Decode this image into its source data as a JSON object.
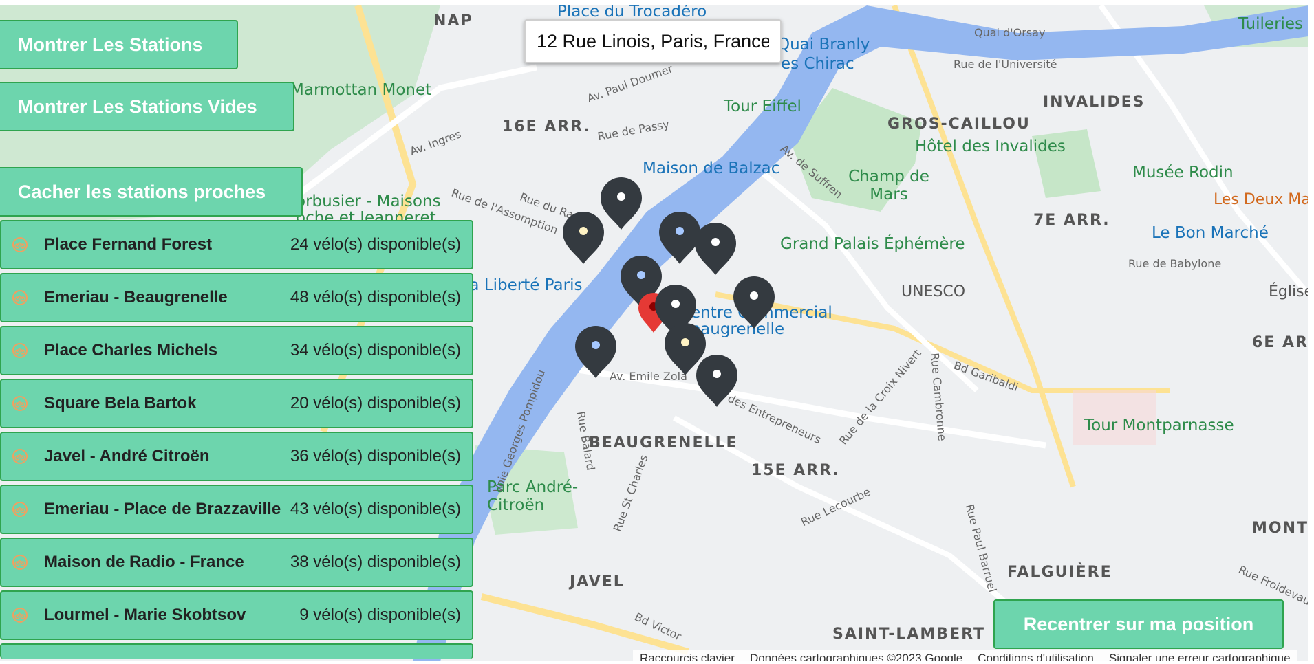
{
  "search": {
    "value": "12 Rue Linois, Paris, France"
  },
  "buttons": {
    "show_stations": "Montrer Les Stations",
    "show_empty": "Montrer Les Stations Vides",
    "hide_nearby": "Cacher les stations proches",
    "recenter": "Recentrer sur ma position"
  },
  "stations": [
    {
      "name": "Place Fernand Forest",
      "count": "24 vélo(s) disponible(s)"
    },
    {
      "name": "Emeriau - Beaugrenelle",
      "count": "48 vélo(s) disponible(s)"
    },
    {
      "name": "Place Charles Michels",
      "count": "34 vélo(s) disponible(s)"
    },
    {
      "name": "Square Bela Bartok",
      "count": "20 vélo(s) disponible(s)"
    },
    {
      "name": "Javel - André Citroën",
      "count": "36 vélo(s) disponible(s)"
    },
    {
      "name": "Emeriau - Place de Brazzaville",
      "count": "43 vélo(s) disponible(s)"
    },
    {
      "name": "Maison de Radio - France",
      "count": "38 vélo(s) disponible(s)"
    },
    {
      "name": "Lourmel - Marie Skobtsov",
      "count": "9 vélo(s) disponible(s)"
    }
  ],
  "map_labels": {
    "trocadero": "Place du Trocadéro",
    "nap": "NAP",
    "quai_branly": "Quai Branly",
    "chirac": "es Chirac",
    "quai_orsay": "Quai d'Orsay",
    "tuileries": "Tuileries",
    "rue_universite": "Rue de l'Université",
    "marmottan": "Musée Marmottan Monet",
    "paul_doumer": "Av. Paul Doumer",
    "invalides": "INVALIDES",
    "tour_eiffel": "Tour Eiffel",
    "gros_caillou": "GROS-CAILLOU",
    "arr16": "16E ARR.",
    "rue_passy": "Rue de Passy",
    "hotel_invalides": "Hôtel des Invalides",
    "ingres": "Av. Ingres",
    "balzac": "Maison de Balzac",
    "suffren": "Av. de Suffren",
    "musee_rodin": "Musée Rodin",
    "champ_mars": "Champ de Mars",
    "corbusier": "orbusier - Maisons",
    "jeanneret": "oche et Jeanneret",
    "arr7": "7E ARR.",
    "deux_magots": "Les Deux Ma",
    "rue_ranelagh": "Rue du Ra",
    "assomption": "Rue de l'Assomption",
    "grand_palais": "Grand Palais Éphémère",
    "bon_marche": "Le Bon Marché",
    "babylone": "Rue de Babylone",
    "liberte": "la Liberté Paris",
    "unesco": "UNESCO",
    "eglise": "Église",
    "centre_co": "entre Commercial",
    "beaugrenelle_centre": "eaugrenelle",
    "arr6": "6E ARR",
    "bd_garibaldi": "Bd Garibaldi",
    "emile_zola": "Av. Emile Zola",
    "croix_nivert": "Rue de la Croix Nivert",
    "cambronne": "Rue Cambronne",
    "entrepreneurs": "des Entrepreneurs",
    "pompidou": "Voie Georges Pompidou",
    "tour_montparnasse": "Tour Montparnasse",
    "rue_balard": "Rue Balard",
    "beaugrenelle": "BEAUGRENELLE",
    "arr15": "15E ARR.",
    "parc_citroen": "Parc André-Citroën",
    "st_charles": "Rue St Charles",
    "lecourbe": "Rue Lecourbe",
    "montp": "MONTP",
    "paul_barruel": "Rue Paul Barruel",
    "falguiere": "FALGUIÈRE",
    "froidevaux": "Rue Froidevau",
    "javel": "JAVEL",
    "bd_victor": "Bd Victor",
    "saint_lambert": "SAINT-LAMBERT"
  },
  "footer": {
    "shortcuts": "Raccourcis clavier",
    "data": "Données cartographiques ©2023 Google",
    "terms": "Conditions d'utilisation",
    "report": "Signaler une erreur cartographique"
  },
  "colors": {
    "button_bg": "#6dd5ad",
    "button_border": "#2fa44f",
    "marker": "#343a40",
    "user_marker": "#e53935",
    "river": "#94b7f0"
  }
}
